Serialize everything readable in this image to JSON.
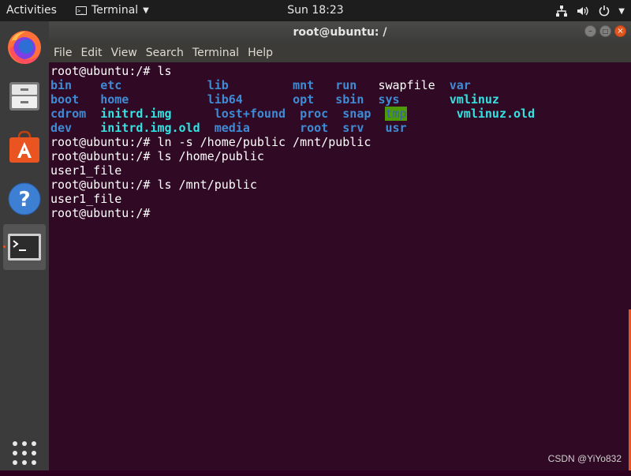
{
  "topbar": {
    "activities": "Activities",
    "app_name": "Terminal",
    "clock": "Sun 18:23"
  },
  "dock": {
    "items": [
      "firefox",
      "files",
      "ubuntu-software",
      "help",
      "terminal"
    ]
  },
  "window": {
    "title": "root@ubuntu: /",
    "menu": [
      "File",
      "Edit",
      "View",
      "Search",
      "Terminal",
      "Help"
    ]
  },
  "terminal": {
    "lines": [
      "root@ubuntu:/# ls",
      [
        "bin",
        "etc",
        "lib",
        "mnt",
        "run",
        "swapfile",
        "var"
      ],
      [
        "boot",
        "home",
        "lib64",
        "opt",
        "sbin",
        "sys",
        "vmlinuz"
      ],
      [
        "cdrom",
        "initrd.img",
        "lost+found",
        "proc",
        "snap",
        "tmp",
        "vmlinuz.old"
      ],
      [
        "dev",
        "initrd.img.old",
        "media",
        "root",
        "srv",
        "usr"
      ],
      "root@ubuntu:/# ln -s /home/public /mnt/public",
      "root@ubuntu:/# ls /home/public",
      "user1_file",
      "root@ubuntu:/# ls /mnt/public",
      "user1_file",
      "root@ubuntu:/#"
    ]
  },
  "watermark": "CSDN @YiYo832",
  "colors": {
    "terminal_bg": "#300a24",
    "accent": "#e95420",
    "dir": "#3f8bd6",
    "symlink": "#34e2e2",
    "sticky_dir_bg": "#4e9a06"
  }
}
